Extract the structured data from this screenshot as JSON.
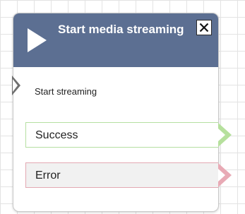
{
  "block": {
    "title": "Start media streaming",
    "action_label": "Start streaming",
    "close_symbol": "close-icon"
  },
  "branches": [
    {
      "label": "Success",
      "color": "#b5dfa1"
    },
    {
      "label": "Error",
      "color": "#e3a8b2"
    }
  ],
  "colors": {
    "header": "#5c6f92",
    "input_connector": "#6f6f6f"
  },
  "icons": {
    "header_icon": "play-icon",
    "input": "input-connector-icon",
    "success_output": "success-output-arrow-icon",
    "error_output": "error-output-arrow-icon"
  }
}
